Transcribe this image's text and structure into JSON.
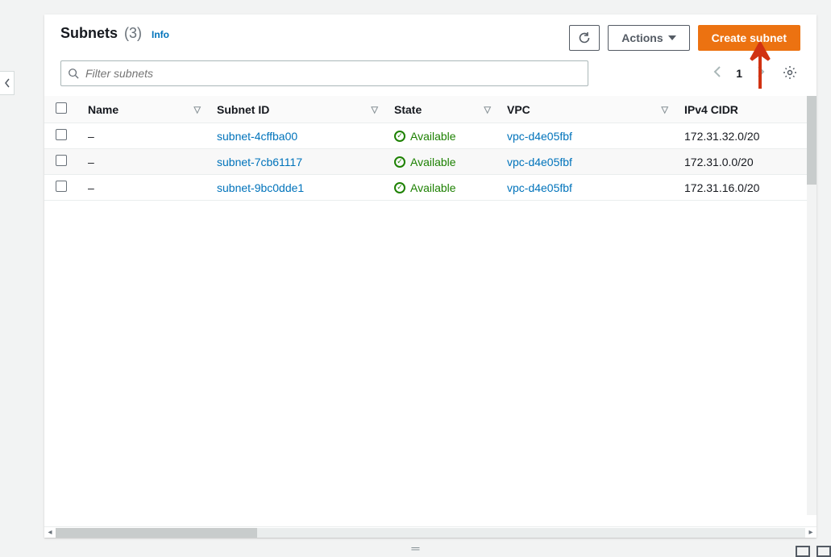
{
  "header": {
    "title": "Subnets",
    "count": "(3)",
    "info_label": "Info",
    "refresh_aria": "Refresh",
    "actions_label": "Actions",
    "create_label": "Create subnet"
  },
  "filter": {
    "placeholder": "Filter subnets"
  },
  "pagination": {
    "page": "1"
  },
  "columns": {
    "name": "Name",
    "subnet_id": "Subnet ID",
    "state": "State",
    "vpc": "VPC",
    "ipv4_cidr": "IPv4 CIDR"
  },
  "rows": [
    {
      "name": "–",
      "subnet_id": "subnet-4cffba00",
      "state": "Available",
      "vpc": "vpc-d4e05fbf",
      "ipv4_cidr": "172.31.32.0/20"
    },
    {
      "name": "–",
      "subnet_id": "subnet-7cb61117",
      "state": "Available",
      "vpc": "vpc-d4e05fbf",
      "ipv4_cidr": "172.31.0.0/20"
    },
    {
      "name": "–",
      "subnet_id": "subnet-9bc0dde1",
      "state": "Available",
      "vpc": "vpc-d4e05fbf",
      "ipv4_cidr": "172.31.16.0/20"
    }
  ],
  "annotation": {
    "color": "#d13212"
  }
}
